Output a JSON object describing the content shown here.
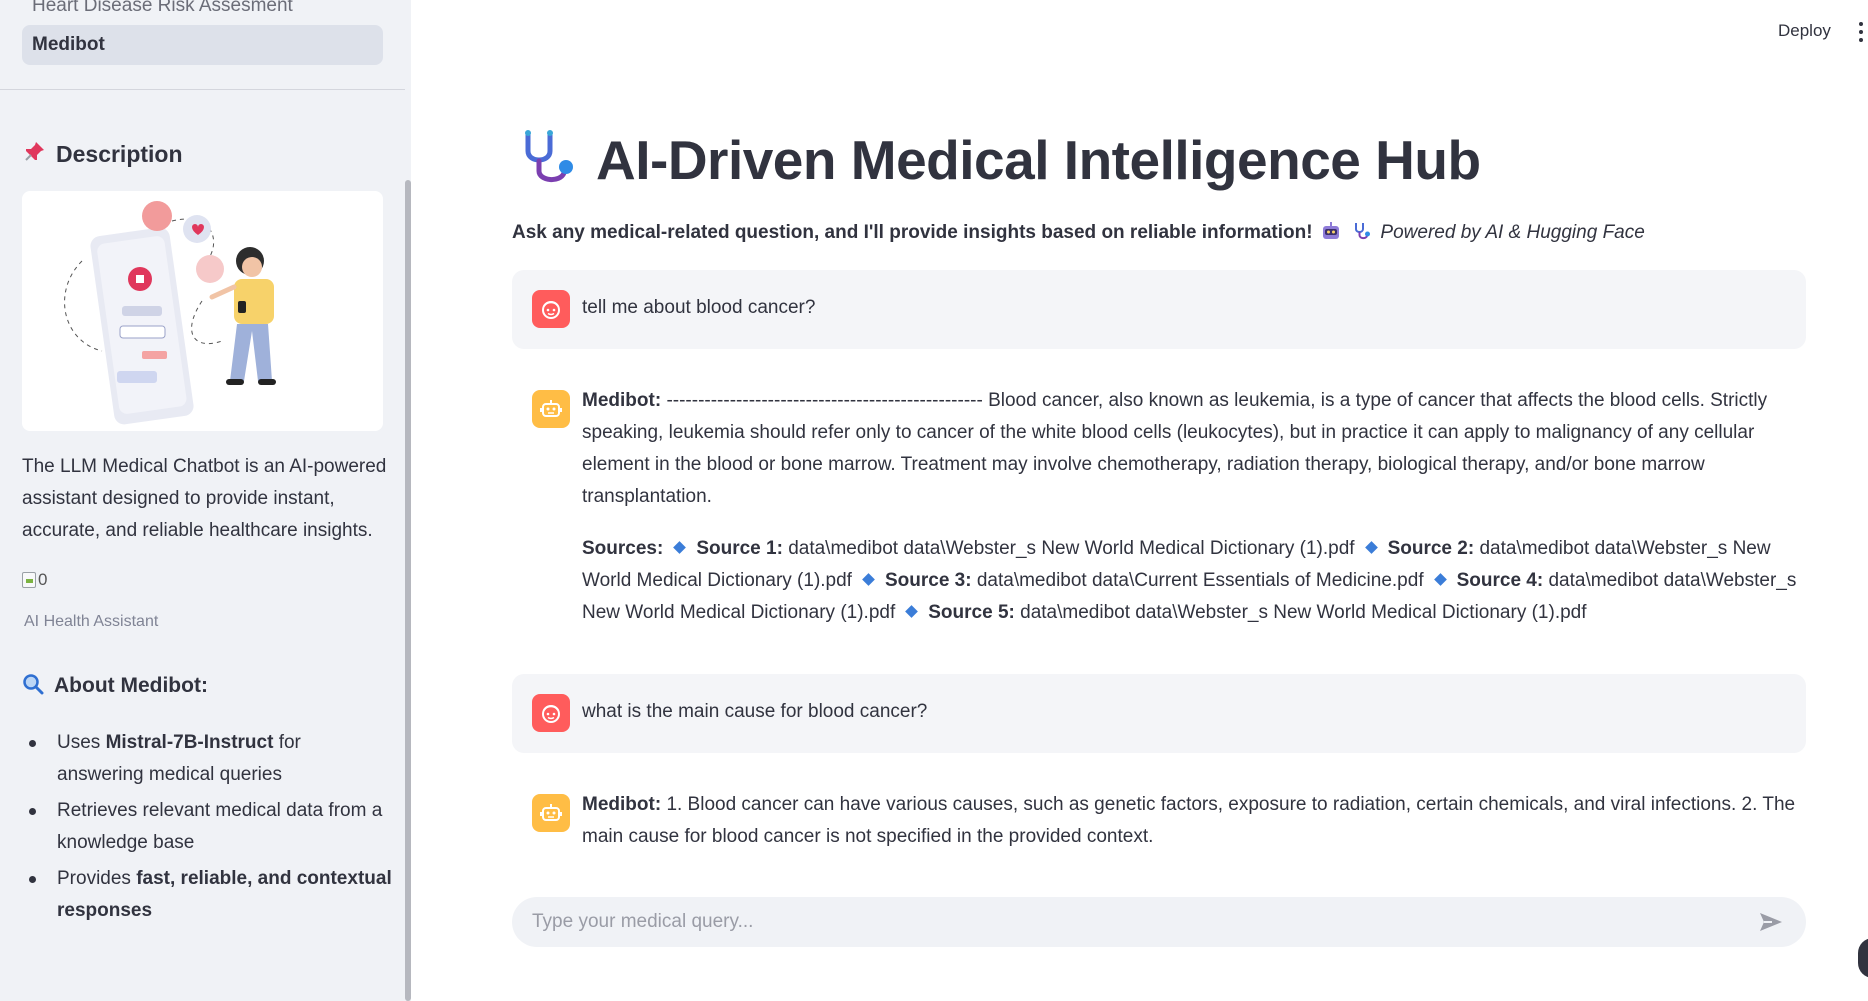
{
  "sidebar": {
    "nav_inactive": "Heart Disease Risk Assesment",
    "nav_active": "Medibot",
    "description_heading": "Description",
    "intro": "The LLM Medical Chatbot is an AI-powered assistant designed to provide instant, accurate, and reliable healthcare insights.",
    "broken_image_alt": "0",
    "caption": "AI Health Assistant",
    "about_heading": "About Medibot:",
    "about_items": [
      {
        "pre": "Uses ",
        "bold": "Mistral-7B-Instruct",
        "post": " for answering medical queries"
      },
      {
        "pre": "Retrieves relevant medical data from a knowledge base",
        "bold": "",
        "post": ""
      },
      {
        "pre": "Provides ",
        "bold": "fast, reliable, and contextual responses",
        "post": ""
      }
    ]
  },
  "header": {
    "deploy_label": "Deploy"
  },
  "main": {
    "title": "AI-Driven Medical Intelligence Hub",
    "subtitle_bold": "Ask any medical-related question, and I'll provide insights based on reliable information!",
    "subtitle_italic": "Powered by AI & Hugging Face",
    "messages": [
      {
        "role": "user",
        "text": "tell me about blood cancer?"
      },
      {
        "role": "bot",
        "label": "Medibot:",
        "text": "-------------------------------------------------- Blood cancer, also known as leukemia, is a type of cancer that affects the blood cells. Strictly speaking, leukemia should refer only to cancer of the white blood cells (leukocytes), but in practice it can apply to malignancy of any cellular element in the blood or bone marrow. Treatment may involve chemotherapy, radiation therapy, biological therapy, and/or bone marrow transplantation.",
        "sources_label": "Sources:",
        "sources": [
          {
            "label": "Source 1:",
            "path": "data\\medibot data\\Webster_s New World Medical Dictionary (1).pdf"
          },
          {
            "label": "Source 2:",
            "path": "data\\medibot data\\Webster_s New World Medical Dictionary (1).pdf"
          },
          {
            "label": "Source 3:",
            "path": "data\\medibot data\\Current Essentials of Medicine.pdf"
          },
          {
            "label": "Source 4:",
            "path": "data\\medibot data\\Webster_s New World Medical Dictionary (1).pdf"
          },
          {
            "label": "Source 5:",
            "path": "data\\medibot data\\Webster_s New World Medical Dictionary (1).pdf"
          }
        ]
      },
      {
        "role": "user",
        "text": "what is the main cause for blood cancer?"
      },
      {
        "role": "bot",
        "label": "Medibot:",
        "text": "1. Blood cancer can have various causes, such as genetic factors, exposure to radiation, certain chemicals, and viral infections. 2. The main cause for blood cancer is not specified in the provided context."
      }
    ],
    "input_placeholder": "Type your medical query..."
  },
  "icons": {
    "pin": "pushpin-icon",
    "magnifier": "magnifier-icon",
    "stethoscope": "stethoscope-icon",
    "robot": "robot-icon",
    "user_face": "user-face-icon",
    "send": "send-icon",
    "menu": "kebab-menu-icon"
  },
  "colors": {
    "user_avatar": "#ff5c5c",
    "bot_avatar": "#ffbd45",
    "source_diamond": "#3b7dd8",
    "sidebar_bg": "#f0f2f6"
  }
}
